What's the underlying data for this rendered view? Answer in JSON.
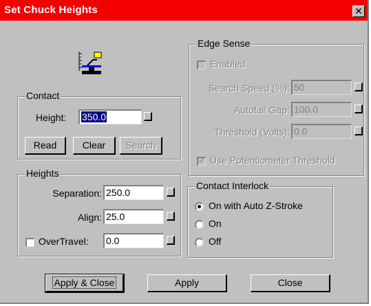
{
  "window": {
    "title": "Set Chuck Heights",
    "close_glyph": "✕"
  },
  "icon": {
    "name": "chuck-height-icon"
  },
  "contact": {
    "legend": "Contact",
    "height_label": "Height:",
    "height_value": "350.0",
    "read_label": "Read",
    "clear_label": "Clear",
    "search_label": "Search"
  },
  "heights": {
    "legend": "Heights",
    "separation_label": "Separation:",
    "separation_value": "250.0",
    "align_label": "Align:",
    "align_value": "25.0",
    "overtravel_label": "OverTravel:",
    "overtravel_value": "0.0",
    "overtravel_checked": false
  },
  "edge_sense": {
    "legend": "Edge Sense",
    "enabled_label": "Enabled",
    "search_speed_label": "Search Speed (%):",
    "search_speed_value": "50",
    "autofail_label": "Autofail Gap:",
    "autofail_value": "100.0",
    "threshold_label": "Threshold (Volts):",
    "threshold_value": "0.0",
    "use_pot_label": "Use Potentiometer Threshold",
    "use_pot_checked": true
  },
  "interlock": {
    "legend": "Contact Interlock",
    "options": [
      "On with Auto Z-Stroke",
      "On",
      "Off"
    ],
    "selected": "On with Auto Z-Stroke"
  },
  "buttons": {
    "apply_close": "Apply & Close",
    "apply": "Apply",
    "close": "Close"
  }
}
